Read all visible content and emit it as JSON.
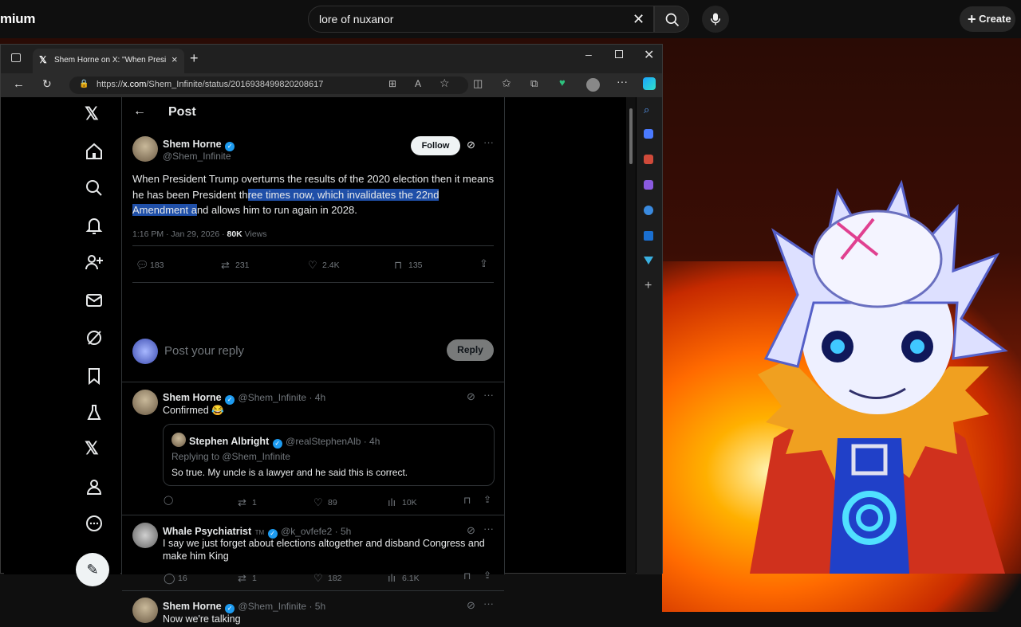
{
  "youtube": {
    "logo_text": "mium",
    "search_query": "lore of nuxanor",
    "create_label": "Create"
  },
  "browser": {
    "tab_title": "Shem Horne on X: \"When Presid",
    "url_prefix": "https://",
    "url_domain": "x.com",
    "url_path": "/Shem_Infinite/status/2016938499820208617"
  },
  "x": {
    "header_title": "Post",
    "main_post": {
      "author_name": "Shem Horne",
      "author_handle": "@Shem_Infinite",
      "follow_label": "Follow",
      "text_before_highlight": "When President Trump overturns the results of the 2020 election then it means he has been President th",
      "text_highlight": "ree times now, which invalidates the 22nd Amendment a",
      "text_after_highlight": "nd allows him to run again in 2028.",
      "timestamp": "1:16 PM · Jan 29, 2026 · ",
      "views_count": "80K",
      "views_label": " Views",
      "replies": "183",
      "reposts": "231",
      "likes": "2.4K",
      "bookmarks": "135"
    },
    "reply_box": {
      "placeholder": "Post your reply",
      "button_label": "Reply"
    },
    "replies": [
      {
        "author_name": "Shem Horne",
        "author_handle": "@Shem_Infinite · 4h",
        "text": "Confirmed 😂",
        "quote": {
          "author_name": "Stephen Albright",
          "author_handle": "@realStephenAlb · 4h",
          "replying_to": "Replying to @Shem_Infinite",
          "text": "So true. My uncle is a lawyer and he said this is correct."
        },
        "reposts": "1",
        "likes": "89",
        "views": "10K"
      },
      {
        "author_name": "Whale Psychiatrist",
        "author_tm": "TM",
        "author_handle": "@k_ovfefe2 · 5h",
        "text": "I say we just forget about elections altogether and disband Congress and make him King",
        "replies": "16",
        "reposts": "1",
        "likes": "182",
        "views": "6.1K"
      },
      {
        "author_name": "Shem Horne",
        "author_handle": "@Shem_Infinite · 5h",
        "text": "Now we're talking"
      }
    ]
  },
  "colors": {
    "accent": "#1d9bf0",
    "highlight": "#1f4fa8",
    "muted": "#71767b"
  }
}
